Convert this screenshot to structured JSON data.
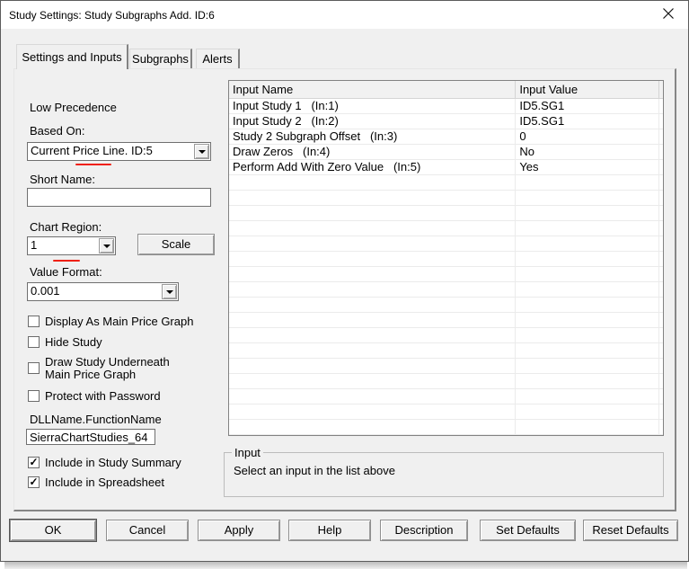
{
  "window": {
    "title": "Study Settings: Study Subgraphs Add. ID:6"
  },
  "icons": {
    "checkmark": "✓",
    "dropdown": "triangle-down",
    "close": "x-cross"
  },
  "tabs": [
    {
      "label": "Settings and Inputs",
      "active": true
    },
    {
      "label": "Subgraphs",
      "active": false
    },
    {
      "label": "Alerts",
      "active": false
    }
  ],
  "left_panel": {
    "precedence_label": "Low Precedence",
    "based_on": {
      "label": "Based On:",
      "value": "Current Price Line. ID:5"
    },
    "short_name": {
      "label": "Short Name:",
      "value": ""
    },
    "chart_region": {
      "label": "Chart Region:",
      "value": "1"
    },
    "scale_button_label": "Scale",
    "value_format": {
      "label": "Value Format:",
      "value": "0.001"
    },
    "checkboxes": [
      {
        "label": "Display As Main Price Graph",
        "checked": false
      },
      {
        "label": "Hide Study",
        "checked": false
      },
      {
        "label": "Draw Study Underneath Main Price Graph",
        "checked": false
      },
      {
        "label": "Protect with Password",
        "checked": false
      }
    ],
    "dll": {
      "label": "DLLName.FunctionName",
      "value": "SierraChartStudies_64"
    },
    "include_checkboxes": [
      {
        "label": "Include in Study Summary",
        "checked": true
      },
      {
        "label": "Include in Spreadsheet",
        "checked": true
      }
    ]
  },
  "inputs_table": {
    "columns": [
      "Input Name",
      "Input Value"
    ],
    "rows": [
      {
        "name": "Input Study 1   (In:1)",
        "value": "ID5.SG1"
      },
      {
        "name": "Input Study 2   (In:2)",
        "value": "ID5.SG1"
      },
      {
        "name": "Study 2 Subgraph Offset   (In:3)",
        "value": "0"
      },
      {
        "name": "Draw Zeros   (In:4)",
        "value": "No"
      },
      {
        "name": "Perform Add With Zero Value   (In:5)",
        "value": "Yes"
      }
    ],
    "empty_row_count": 18
  },
  "input_group": {
    "title": "Input",
    "message": "Select an input in the list above"
  },
  "buttons": [
    "OK",
    "Cancel",
    "Apply",
    "Help",
    "Description",
    "Set Defaults",
    "Reset Defaults"
  ],
  "colors": {
    "annotation_red": "#ef2011",
    "dialog_bg": "#f0f0f0",
    "titlebar_bg": "#ffffff",
    "accent_border": "#5c5c5c"
  }
}
